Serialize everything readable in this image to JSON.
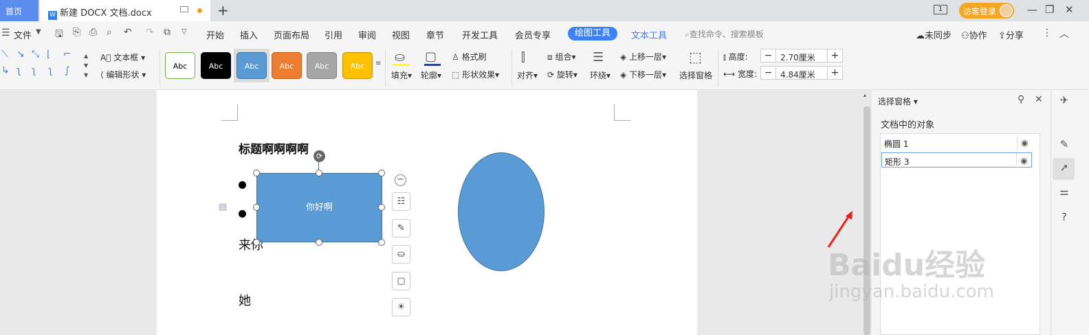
{
  "tabs": {
    "home": "首页",
    "doc_title": "新建 DOCX 文档.docx",
    "doc_icon": "W",
    "new_tab": "+"
  },
  "titlebar": {
    "badge_num": "1",
    "login": "访客登录"
  },
  "menu": {
    "file": "文件",
    "items": [
      "开始",
      "插入",
      "页面布局",
      "引用",
      "审阅",
      "视图",
      "章节",
      "开发工具",
      "会员专享"
    ],
    "draw_tools": "绘图工具",
    "text_tools": "文本工具",
    "search": "查找命令、搜索模板",
    "sync": "未同步",
    "collab": "协作",
    "share": "分享"
  },
  "ribbon": {
    "textbox": "文本框",
    "edit_shape": "编辑形状",
    "styles": [
      {
        "label": "Abc",
        "bg": "#ffffff",
        "fg": "#000000",
        "border": "#70ad47"
      },
      {
        "label": "Abc",
        "bg": "#000000",
        "fg": "#ffffff",
        "border": "#000000"
      },
      {
        "label": "Abc",
        "bg": "#5b9bd5",
        "fg": "#ffffff",
        "border": "#41719c"
      },
      {
        "label": "Abc",
        "bg": "#ed7d31",
        "fg": "#ffffff",
        "border": "#c55a11"
      },
      {
        "label": "Abc",
        "bg": "#a5a5a5",
        "fg": "#ffffff",
        "border": "#7f7f7f"
      },
      {
        "label": "Abc",
        "bg": "#ffc000",
        "fg": "#ffffff",
        "border": "#bf9000"
      }
    ],
    "fill": "填充",
    "outline": "轮廓",
    "format_painter": "格式刷",
    "shape_effect": "形状效果",
    "align": "对齐",
    "group": "组合",
    "rotate": "旋转",
    "wrap": "环绕",
    "bring_forward": "上移一层",
    "send_backward": "下移一层",
    "selection_pane": "选择窗格",
    "height_label": "高度:",
    "height_value": "2.70厘米",
    "width_label": "宽度:",
    "width_value": "4.84厘米"
  },
  "document": {
    "heading": "标题啊啊啊啊",
    "line1": "来你",
    "line2": "她",
    "rect_text": "你好啊"
  },
  "panel": {
    "title": "选择窗格",
    "section": "文档中的对象",
    "objects": [
      "椭圆 1",
      "矩形 3"
    ]
  },
  "watermark": {
    "brand": "Baidu经验",
    "url": "jingyan.baidu.com"
  }
}
